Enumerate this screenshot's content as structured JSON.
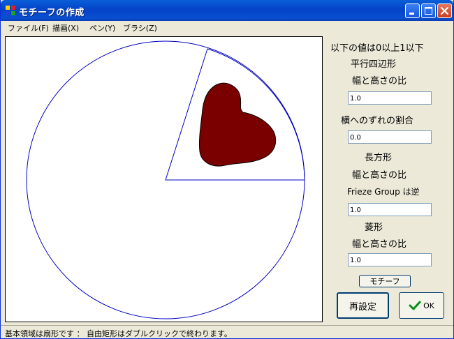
{
  "window": {
    "title": "モチーフの作成"
  },
  "menu": [
    {
      "label": "ファイル(F)"
    },
    {
      "label": "描画(X)"
    },
    {
      "label": "ペン(Y)"
    },
    {
      "label": "ブラシ(Z)"
    }
  ],
  "colors": {
    "motif_fill": "#7a0000",
    "outline": "#0000c0",
    "titlebar": "#0a4fd1"
  },
  "panel": {
    "heading": "以下の値は0以上1以下",
    "parallelogram_label": "平行四辺形",
    "parallelogram_ratio_label": "幅と高さの比",
    "parallelogram_ratio_value": "1.0",
    "shift_label": "横へのずれの割合",
    "shift_value": "0.0",
    "rectangle_label": "長方形",
    "rectangle_ratio_label": "幅と高さの比",
    "frieze_label": "Frieze Group は逆",
    "rectangle_ratio_value": "1.0",
    "rhombus_label": "菱形",
    "rhombus_ratio_label": "幅と高さの比",
    "rhombus_ratio_value": "1.0",
    "motif_button": "モチーフ",
    "reset_button": "再設定",
    "ok_button": "OK"
  },
  "status": {
    "text": "基本領域は扇形です ： 自由矩形はダブルクリックで終わります。"
  }
}
